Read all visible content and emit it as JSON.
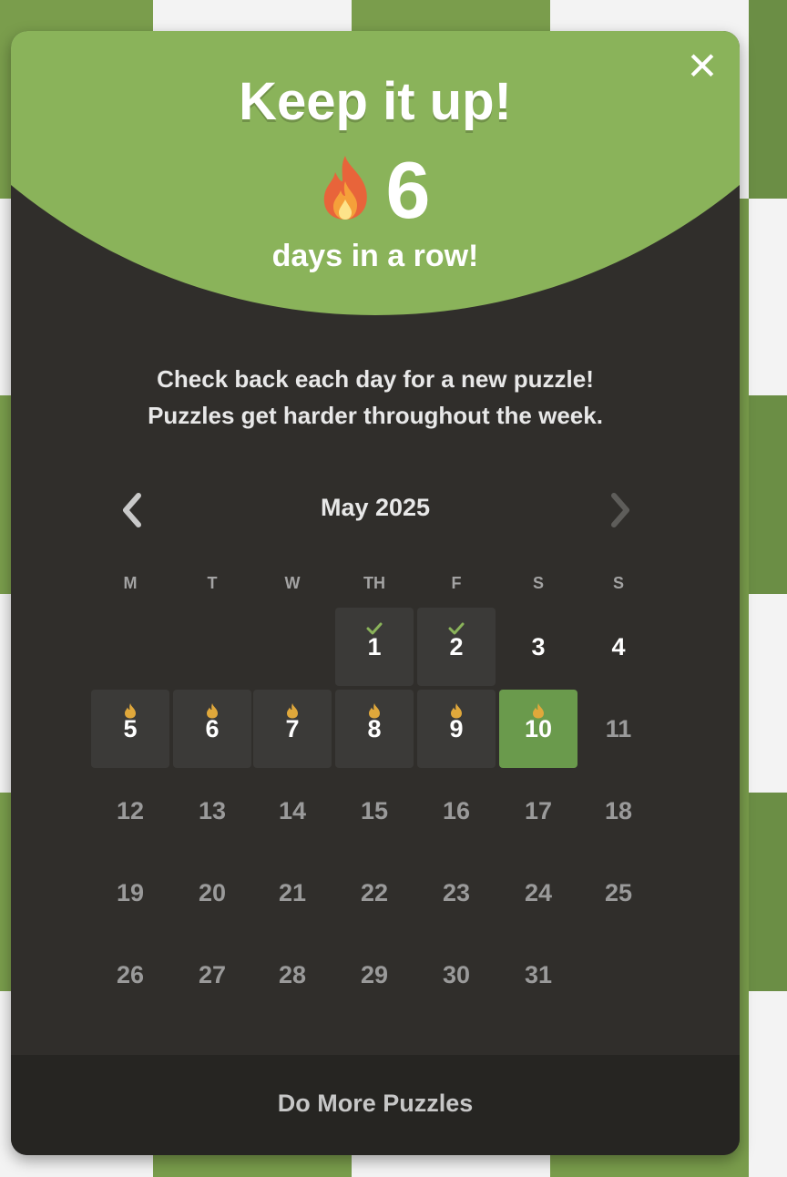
{
  "header": {
    "title": "Keep it up!",
    "streak_count": "6",
    "streak_label": "days in a row!",
    "close_icon": "close-icon"
  },
  "message": {
    "line1": "Check back each day for a new puzzle!",
    "line2": "Puzzles get harder throughout the week."
  },
  "calendar": {
    "month_label": "May 2025",
    "weekdays": [
      "M",
      "T",
      "W",
      "TH",
      "F",
      "S",
      "S"
    ],
    "days": [
      {
        "n": "1",
        "state": "solved",
        "icon": "check-icon"
      },
      {
        "n": "2",
        "state": "solved",
        "icon": "check-icon"
      },
      {
        "n": "3",
        "state": "available"
      },
      {
        "n": "4",
        "state": "available"
      },
      {
        "n": "5",
        "state": "streak",
        "icon": "flame-icon"
      },
      {
        "n": "6",
        "state": "streak",
        "icon": "flame-icon"
      },
      {
        "n": "7",
        "state": "streak",
        "icon": "flame-icon"
      },
      {
        "n": "8",
        "state": "streak",
        "icon": "flame-icon"
      },
      {
        "n": "9",
        "state": "streak",
        "icon": "flame-icon"
      },
      {
        "n": "10",
        "state": "today",
        "icon": "flame-icon"
      },
      {
        "n": "11",
        "state": "future"
      },
      {
        "n": "12",
        "state": "future"
      },
      {
        "n": "13",
        "state": "future"
      },
      {
        "n": "14",
        "state": "future"
      },
      {
        "n": "15",
        "state": "future"
      },
      {
        "n": "16",
        "state": "future"
      },
      {
        "n": "17",
        "state": "future"
      },
      {
        "n": "18",
        "state": "future"
      },
      {
        "n": "19",
        "state": "future"
      },
      {
        "n": "20",
        "state": "future"
      },
      {
        "n": "21",
        "state": "future"
      },
      {
        "n": "22",
        "state": "future"
      },
      {
        "n": "23",
        "state": "future"
      },
      {
        "n": "24",
        "state": "future"
      },
      {
        "n": "25",
        "state": "future"
      },
      {
        "n": "26",
        "state": "future"
      },
      {
        "n": "27",
        "state": "future"
      },
      {
        "n": "28",
        "state": "future"
      },
      {
        "n": "29",
        "state": "future"
      },
      {
        "n": "30",
        "state": "future"
      },
      {
        "n": "31",
        "state": "future"
      }
    ],
    "first_weekday_index": 3
  },
  "footer": {
    "button_label": "Do More Puzzles"
  },
  "colors": {
    "accent_green": "#8ab35a",
    "today_green": "#6a9a4c",
    "panel": "#302e2b",
    "flame_gold": "#e0a83b"
  }
}
